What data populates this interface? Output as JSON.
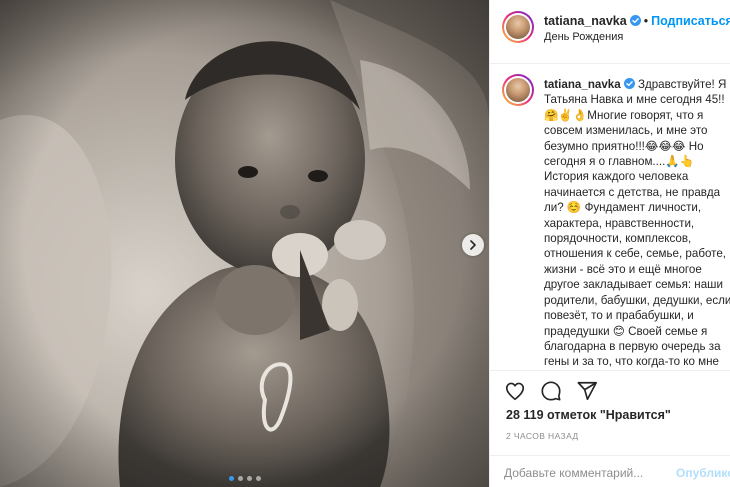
{
  "post": {
    "username": "tatiana_navka",
    "header_separator": "•",
    "follow_label": "Подписаться",
    "location": "День Рождения",
    "caption_text": "Здравствуйте! Я Татьяна Навка и мне сегодня 45!!🤗✌️👌Многие говорят, что я совсем изменилась, и мне это безумно приятно!!!😂😂😂 Но сегодня я о главном....🙏👆 История каждого человека начинается с детства, не правда ли? ☺️ Фундамент личности, характера, нравственности, порядочности, комплексов, отношения к себе, семье, работе, жизни - всё это и ещё многое другое закладывает семья: наши родители, бабушки, дедушки, если повезёт, то и прабабушки, и прадедушки 😊 Своей семье я благодарна в первую очередь за гены и за то, что когда-то ко мне маленькой прислушались.",
    "likes": "28 119 отметок \"Нравится\"",
    "time": "2 ЧАСОВ НАЗАД",
    "comment_placeholder": "Добавьте комментарий...",
    "publish_label": "Опубликовать"
  },
  "carousel": {
    "slide_count": 4,
    "active_index": 0
  },
  "icons": {
    "like": "heart-icon",
    "comment": "comment-icon",
    "share": "share-icon",
    "next": "chevron-right-icon",
    "verified": "verified-badge-icon"
  },
  "colors": {
    "accent": "#0095f6",
    "publish_disabled": "#b2dffc",
    "verified": "#3897f0",
    "muted": "#8e8e8e"
  }
}
